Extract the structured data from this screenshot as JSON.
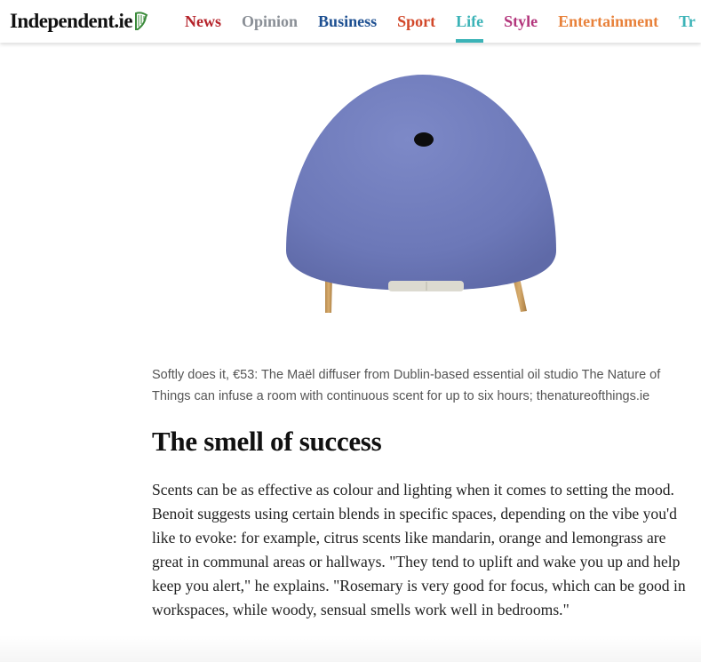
{
  "header": {
    "logo_text": "Independent.ie",
    "logo_icon": "harp-icon",
    "nav": [
      {
        "label": "News",
        "color": "#b5232a"
      },
      {
        "label": "Opinion",
        "color": "#8a8f96"
      },
      {
        "label": "Business",
        "color": "#1d4f91"
      },
      {
        "label": "Sport",
        "color": "#d2482a"
      },
      {
        "label": "Life",
        "color": "#3bb3b7",
        "active": true
      },
      {
        "label": "Style",
        "color": "#b3357c"
      },
      {
        "label": "Entertainment",
        "color": "#e8813a"
      },
      {
        "label": "Tr",
        "color": "#3bb3b7"
      }
    ]
  },
  "article": {
    "hero_image": "diffuser-image",
    "caption": "Softly does it, €53: The Maël diffuser from Dublin-based essential oil studio The Nature of Things can infuse a room with continuous scent for up to six hours; thenatureofthings.ie",
    "section_heading": "The smell of success",
    "paragraph": "Scents can be as effective as colour and lighting when it comes to setting the mood. Benoit suggests using certain blends in specific spaces, depending on the vibe you'd like to evoke: for example, citrus scents like mandarin, orange and lemongrass are great in communal areas or hallways. \"They tend to uplift and wake you up and help keep you alert,\" he explains. \"Rosemary is very good for focus, which can be good in workspaces, while woody, sensual smells work well in bedrooms.\""
  }
}
